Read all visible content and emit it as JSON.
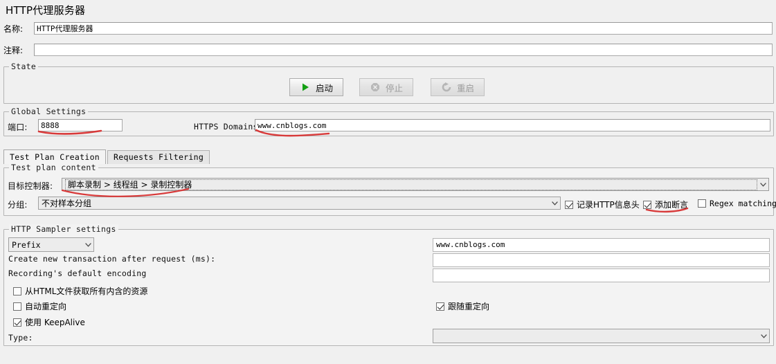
{
  "window": {
    "title": "HTTP代理服务器"
  },
  "form": {
    "name_label": "名称:",
    "name_value": "HTTP代理服务器",
    "comment_label": "注释:",
    "comment_value": ""
  },
  "state": {
    "group_title": "State",
    "start_label": "启动",
    "stop_label": "停止",
    "restart_label": "重启"
  },
  "global_settings": {
    "group_title": "Global Settings",
    "port_label": "端口:",
    "port_value": "8888",
    "https_domains_label": "HTTPS Domains:",
    "https_domains_value": "www.cnblogs.com"
  },
  "tabs": [
    {
      "label": "Test Plan Creation",
      "active": true
    },
    {
      "label": "Requests Filtering",
      "active": false
    }
  ],
  "test_plan_content": {
    "group_title": "Test plan content",
    "target_controller_label": "目标控制器:",
    "target_controller_value": "脚本录制 > 线程组 > 录制控制器",
    "grouping_label": "分组:",
    "grouping_value": "不对样本分组",
    "checkboxes": [
      {
        "label": "记录HTTP信息头",
        "checked": true
      },
      {
        "label": "添加断言",
        "checked": true
      },
      {
        "label": "Regex matching",
        "checked": false
      }
    ]
  },
  "http_sampler_settings": {
    "group_title": "HTTP Sampler settings",
    "prefix_value": "Prefix",
    "transaction_label": "Create new transaction after request (ms):",
    "encoding_label": "Recording's default encoding",
    "field_prefix_value": "www.cnblogs.com",
    "field_transaction_value": "",
    "field_encoding_value": "",
    "checkboxes_left": [
      {
        "label": "从HTML文件获取所有内含的资源",
        "checked": false
      },
      {
        "label": "自动重定向",
        "checked": false
      },
      {
        "label": "使用 KeepAlive",
        "checked": true
      }
    ],
    "checkboxes_right": [
      {
        "label": "跟随重定向",
        "checked": true
      }
    ],
    "type_label": "Type:",
    "type_value": ""
  },
  "annotations": {
    "color": "#d83a3a",
    "marks": [
      "underline-port",
      "underline-https-domains",
      "underline-target-controller",
      "underline-add-assertion"
    ]
  },
  "icons": {
    "start": "play-icon",
    "stop": "stop-icon",
    "restart": "restart-icon",
    "chevron": "chevron-down-icon"
  }
}
